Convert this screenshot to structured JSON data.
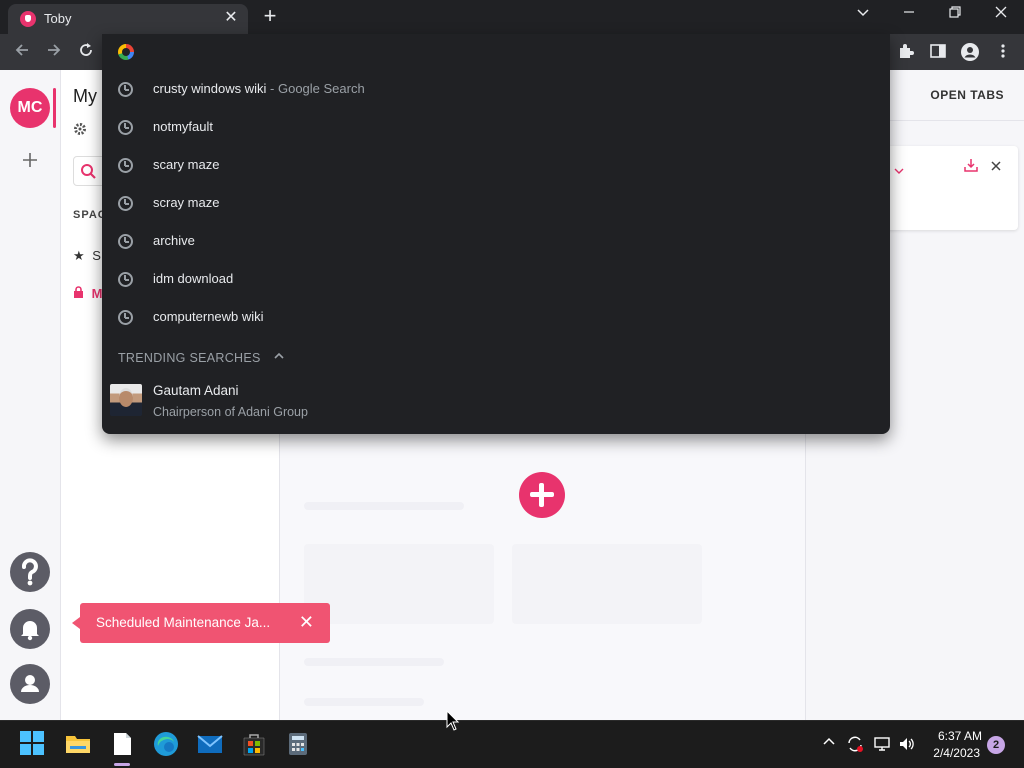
{
  "browser": {
    "tab_title": "Toby",
    "tab_close": "✕",
    "new_tab": "+"
  },
  "toby": {
    "avatar_initials": "MC",
    "collection_title": "My",
    "spaces_label": "SPAC",
    "space_starred": "S",
    "space_private": "M",
    "open_tabs_label": "OPEN TABS"
  },
  "omnibox": {
    "suggestions": [
      {
        "text": "crusty windows wiki",
        "sub": " - Google Search"
      },
      {
        "text": "notmyfault",
        "sub": ""
      },
      {
        "text": "scary maze",
        "sub": ""
      },
      {
        "text": "scray maze",
        "sub": ""
      },
      {
        "text": "archive",
        "sub": ""
      },
      {
        "text": "idm download",
        "sub": ""
      },
      {
        "text": "computernewb wiki",
        "sub": ""
      }
    ],
    "trending_header": "TRENDING SEARCHES",
    "trending": {
      "name": "Gautam Adani",
      "description": "Chairperson of Adani Group"
    }
  },
  "toast": {
    "text": "Scheduled Maintenance Ja...",
    "close": "✕"
  },
  "taskbar": {
    "time": "6:37 AM",
    "date": "2/4/2023",
    "notification_count": "2"
  },
  "colors": {
    "accent": "#e8336d",
    "toast": "#f05472",
    "dropdown_bg": "#202124"
  }
}
